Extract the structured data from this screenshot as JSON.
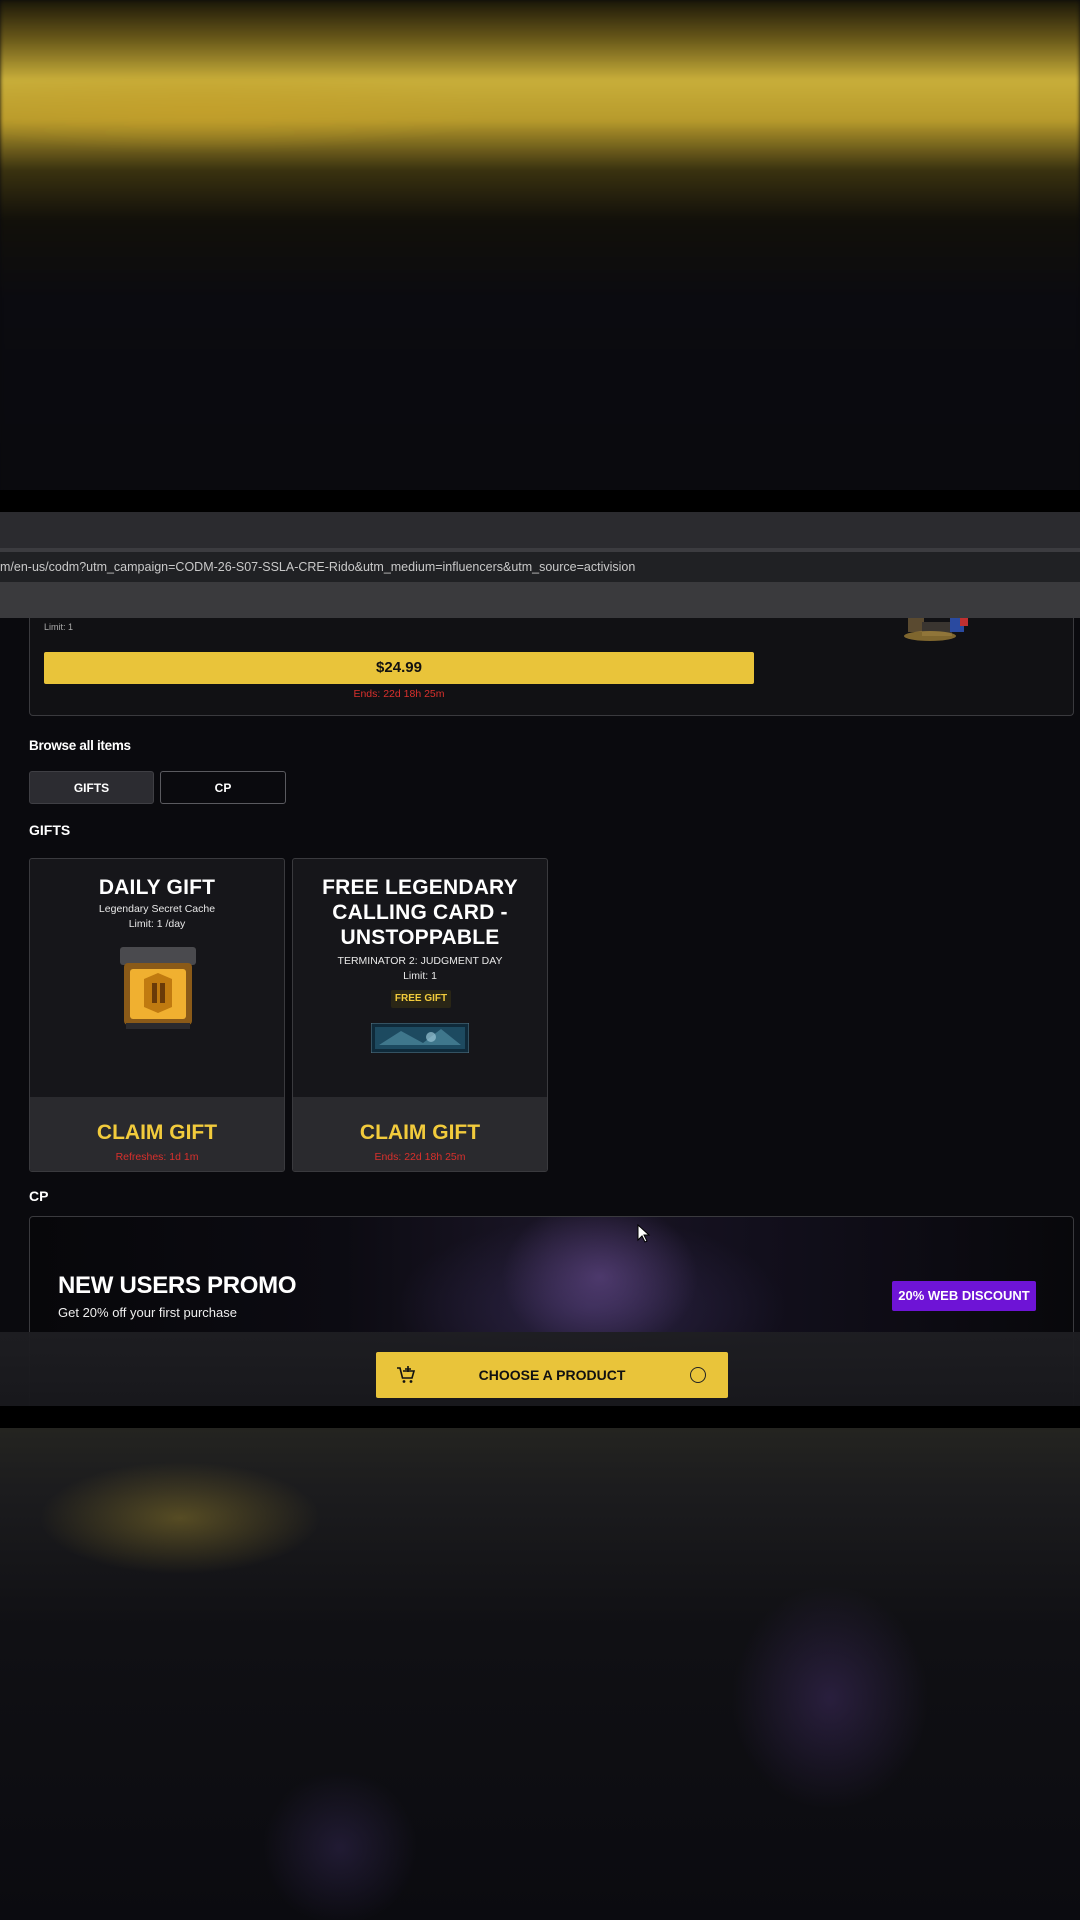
{
  "browser": {
    "url": "m/en-us/codm?utm_campaign=CODM-26-S07-SSLA-CRE-Rido&utm_medium=influencers&utm_source=activision"
  },
  "offer": {
    "limit": "Limit: 1",
    "price": "$24.99",
    "ends": "Ends: 22d 18h 25m"
  },
  "browse": {
    "title": "Browse all items",
    "tabs": [
      "GIFTS",
      "CP"
    ]
  },
  "sections": {
    "gifts": "GIFTS",
    "cp": "CP"
  },
  "gifts": [
    {
      "title": "DAILY GIFT",
      "subtitle": "Legendary Secret Cache",
      "limit": "Limit: 1 /day",
      "action": "CLAIM GIFT",
      "timer": "Refreshes: 1d 1m"
    },
    {
      "title_lines": [
        "FREE LEGENDARY",
        "CALLING CARD -",
        "UNSTOPPABLE"
      ],
      "subtitle": "TERMINATOR 2: JUDGMENT DAY",
      "limit": "Limit: 1",
      "badge": "FREE GIFT",
      "action": "CLAIM GIFT",
      "timer": "Ends: 22d 18h 25m"
    }
  ],
  "promo": {
    "title": "NEW USERS PROMO",
    "subtitle": "Get 20% off your first purchase",
    "badge": "20% WEB DISCOUNT"
  },
  "cta": {
    "label": "CHOOSE A PRODUCT"
  },
  "colors": {
    "accent_yellow": "#e9c43a",
    "timer_red": "#d9302c",
    "promo_purple": "#6e14d6"
  }
}
